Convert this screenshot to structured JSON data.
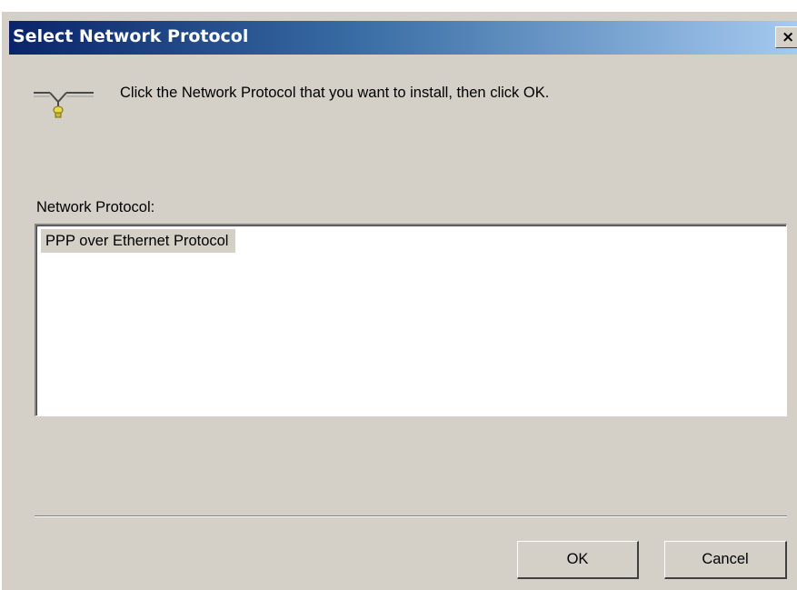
{
  "window": {
    "title": "Select Network Protocol",
    "close_glyph": "×"
  },
  "header": {
    "icon": "network-protocol-icon",
    "instruction": "Click the Network Protocol that you want to install, then click OK."
  },
  "list": {
    "label": "Network Protocol:",
    "items": [
      {
        "label": "PPP over Ethernet Protocol",
        "selected": true
      }
    ]
  },
  "buttons": {
    "ok_label": "OK",
    "cancel_label": "Cancel"
  },
  "colors": {
    "dialog_bg": "#d4d0c8",
    "title_gradient_start": "#0a246a",
    "title_gradient_end": "#a6caf0",
    "title_text": "#ffffff"
  }
}
